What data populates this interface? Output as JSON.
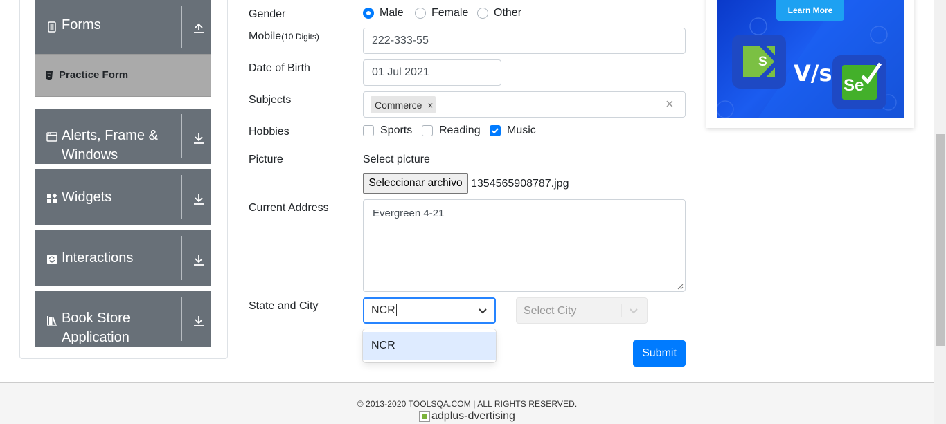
{
  "sidebar": {
    "forms_title": "Forms",
    "practice_form_label": "Practice Form",
    "alerts_title": "Alerts, Frame & Windows",
    "widgets_title": "Widgets",
    "interactions_title": "Interactions",
    "bookstore_title": "Book Store Application"
  },
  "form": {
    "gender_label": "Gender",
    "gender_options": [
      "Male",
      "Female",
      "Other"
    ],
    "gender_selected": "Male",
    "mobile_label": "Mobile",
    "mobile_hint": "(10 Digits)",
    "mobile_value": "222-333-55",
    "dob_label": "Date of Birth",
    "dob_value": "01 Jul 2021",
    "subjects_label": "Subjects",
    "subject_chip": "Commerce",
    "subject_chip_remove": "×",
    "subjects_clear": "×",
    "hobbies_label": "Hobbies",
    "hobbies": [
      {
        "label": "Sports",
        "checked": false
      },
      {
        "label": "Reading",
        "checked": false
      },
      {
        "label": "Music",
        "checked": true
      }
    ],
    "picture_label": "Picture",
    "picture_select_text": "Select picture",
    "file_button_label": "Seleccionar archivo",
    "file_name": "1354565908787.jpg",
    "address_label": "Current Address",
    "address_value": "Evergreen 4-21",
    "state_city_label": "State and City",
    "state_value": "NCR",
    "state_dropdown_option": "NCR",
    "city_placeholder": "Select City",
    "submit_label": "Submit"
  },
  "ad": {
    "learn_more_label": "Learn More",
    "vs_text": "V/s",
    "left_logo_letter": "S",
    "right_logo_text": "Se"
  },
  "footer": {
    "copyright": "© 2013-2020 TOOLSQA.COM | ALL RIGHTS RESERVED.",
    "ad_alt_text": "adplus-dvertising"
  },
  "colors": {
    "accent": "#007bff",
    "sidebar_group": "#687078",
    "active_item": "#aaaaaa",
    "ad_background": "#1b5cf0"
  }
}
